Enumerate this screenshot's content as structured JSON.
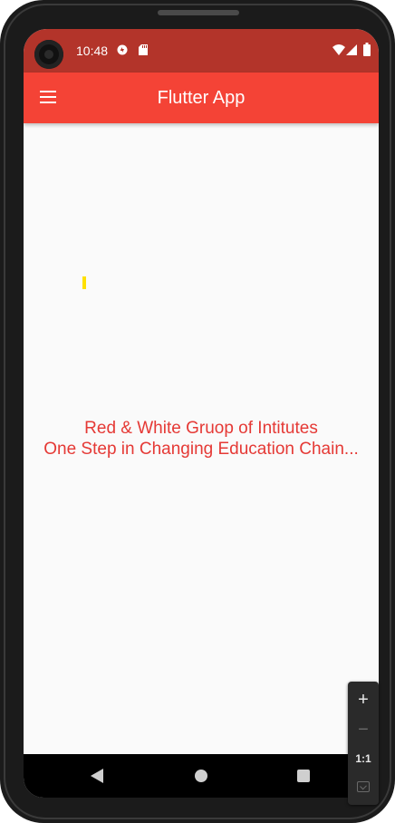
{
  "status_bar": {
    "time": "10:48",
    "icons": [
      "sync-icon",
      "sd-card-icon",
      "wifi-icon",
      "signal-icon",
      "battery-icon"
    ]
  },
  "app_bar": {
    "title": "Flutter App",
    "menu_icon": "hamburger-menu-icon"
  },
  "body": {
    "line1": "Red & White Gruop of Intitutes",
    "line2": "One Step in Changing Education Chain..."
  },
  "nav_bar": {
    "icons": [
      "back-icon",
      "home-icon",
      "recents-icon"
    ]
  },
  "zoom_controls": {
    "zoom_in": "+",
    "zoom_out": "−",
    "ratio": "1:1",
    "fit_icon": "fit-to-screen-icon"
  },
  "colors": {
    "status_bar": "#b3342a",
    "app_bar": "#f44336",
    "body_text": "#e53935",
    "background": "#fafafa"
  }
}
